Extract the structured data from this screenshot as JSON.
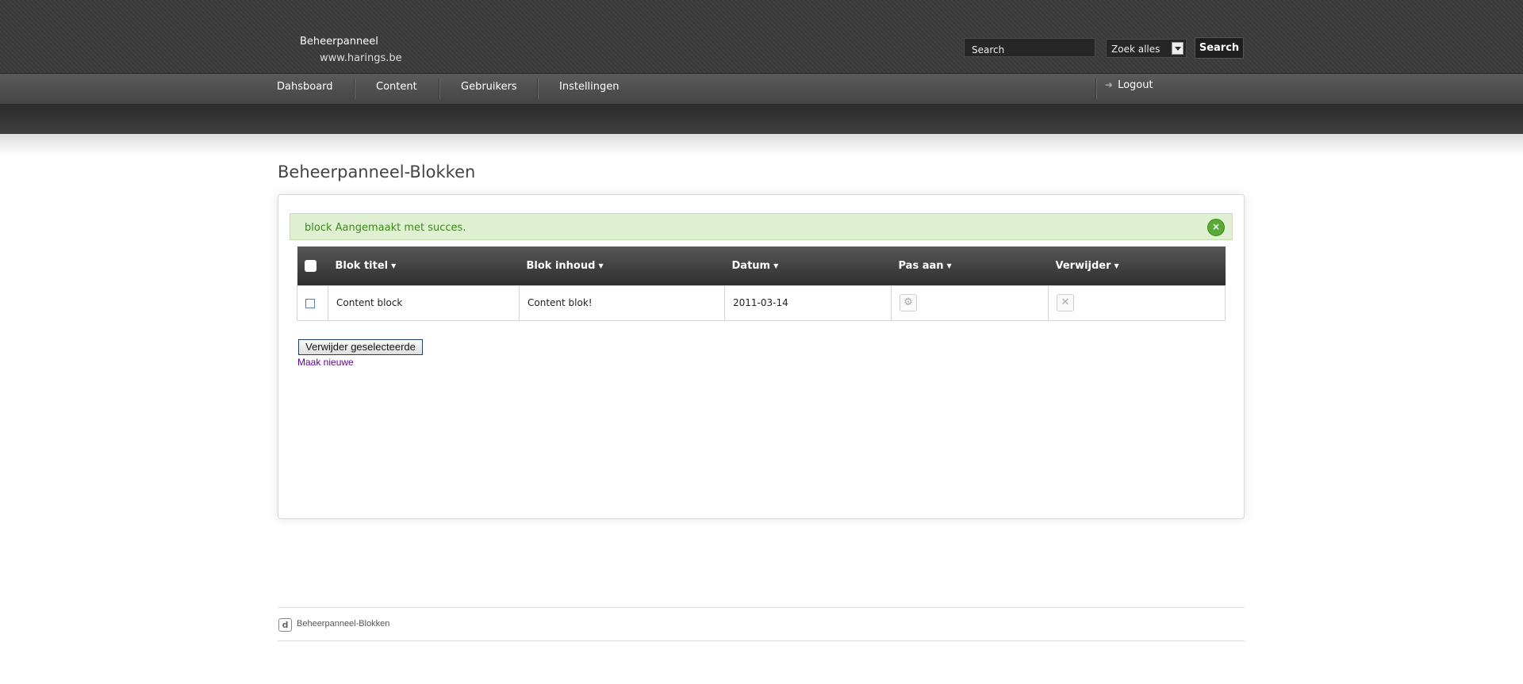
{
  "brand": {
    "title": "Beheerpanneel",
    "url": "www.harings.be"
  },
  "search": {
    "placeholder": "Search",
    "scope": "Zoek alles",
    "button_label": "Search"
  },
  "nav": {
    "items": [
      {
        "label": "Dahsboard"
      },
      {
        "label": "Content"
      },
      {
        "label": "Gebruikers"
      },
      {
        "label": "Instellingen"
      }
    ],
    "logout_label": "Logout"
  },
  "main": {
    "page_title": "Beheerpanneel-Blokken",
    "notice": {
      "text": "block Aangemaakt met succes.",
      "close_symbol": "×"
    },
    "table": {
      "headers": [
        "Blok titel",
        "Blok inhoud",
        "Datum",
        "Pas aan",
        "Verwijder"
      ],
      "rows": [
        {
          "title": "Content block",
          "content": "Content blok!",
          "date": "2011-03-14",
          "edit_icon": "gear-icon",
          "delete_icon": "close-icon"
        }
      ]
    },
    "delete_selected_label": "Verwijder geselecteerde",
    "make_new_label": "Maak nieuwe"
  },
  "footer": {
    "text": "Beheerpanneel-Blokken",
    "icon": "logo-icon"
  },
  "colors": {
    "notice_bg": "#dff0d3",
    "notice_text": "#3d8a1b",
    "header_bg": "#3b3b3b",
    "link_visited": "#660099"
  }
}
